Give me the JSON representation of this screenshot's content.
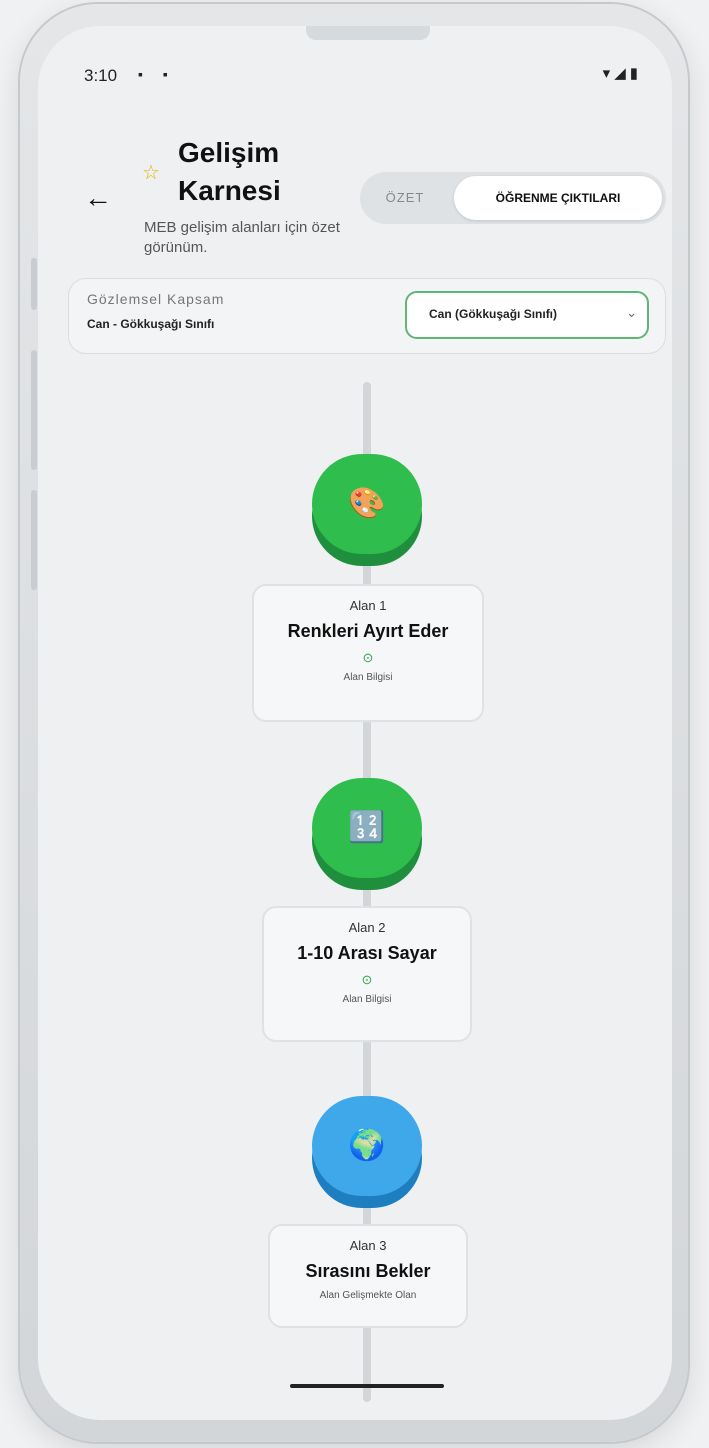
{
  "status_bar": {
    "time": "3:10",
    "left_icons": "▪ ▪",
    "right_icons": "▾◢▮"
  },
  "header": {
    "back_icon": "←",
    "star_icon": "☆",
    "title": "Gelişim Karnesi",
    "subtitle": "MEB gelişim alanları için özet görünüm."
  },
  "tabs": {
    "summary": "ÖZET",
    "outcomes": "ÖĞRENME ÇIKTILARI"
  },
  "filter": {
    "label": "Gözlemsel Kapsam",
    "value": "Can - Gökkuşağı Sınıfı",
    "select_value": "Can (Gökkuşağı Sınıfı)",
    "chevron": "⌄"
  },
  "milestones": [
    {
      "icon": "🎨",
      "tag": "Alan 1",
      "name": "Renkleri Ayırt Eder",
      "check": "⊙",
      "status": "Alan Bilgisi",
      "color": "#2fbd4d"
    },
    {
      "icon": "🔢",
      "tag": "Alan 2",
      "name": "1-10 Arası Sayar",
      "check": "⊙",
      "status": "Alan Bilgisi",
      "color": "#2fbd4d"
    },
    {
      "icon": "🌍",
      "tag": "Alan 3",
      "name": "Sırasını Bekler",
      "check": "",
      "status": "Alan Gelişmekte Olan",
      "color": "#3fa8ea"
    }
  ]
}
